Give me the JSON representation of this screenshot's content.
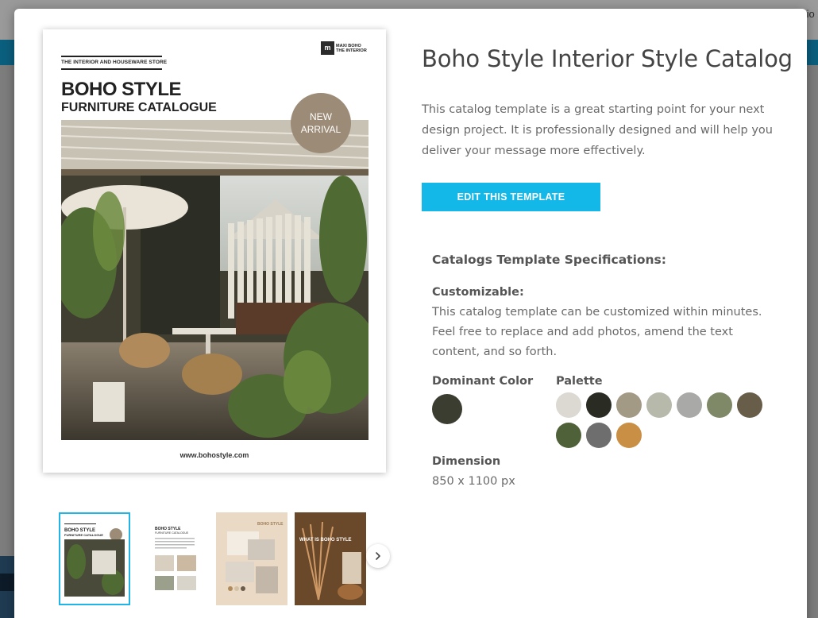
{
  "background": {
    "partial_text": "tio"
  },
  "template": {
    "title": "Boho Style Interior Style Catalog",
    "description": "This catalog template is a great starting point for your next design project. It is professionally designed and will help you deliver your message more effectively.",
    "cta_label": "EDIT THIS TEMPLATE"
  },
  "cover": {
    "store_name": "THE INTERIOR AND HOUSEWARE STORE",
    "title_line1": "BOHO STYLE",
    "title_line2": "FURNITURE CATALOGUE",
    "logo_mark": "m",
    "logo_text": "MAXI BOHO THE INTERIOR",
    "badge_line1": "NEW",
    "badge_line2": "ARRIVAL",
    "url": "www.bohostyle.com"
  },
  "thumbnails": {
    "thumb1": {
      "title": "BOHO STYLE",
      "subtitle": "FURNITURE CATALOGUE"
    },
    "thumb2": {
      "title": "BOHO STYLE",
      "subtitle": "FURNITURE CATALOGUE"
    },
    "thumb3": {
      "title": "BOHO STYLE"
    },
    "thumb4": {
      "title": "WHAT IS BOHO STYLE"
    },
    "next_icon": "chevron-right-icon"
  },
  "specs": {
    "section_title": "Catalogs Template Specifications:",
    "customizable_label": "Customizable:",
    "customizable_text": "This catalog template can be customized within minutes. Feel free to replace and add photos, amend the text content, and so forth.",
    "dominant_color_label": "Dominant Color",
    "dominant_color": "#3b3d30",
    "palette_label": "Palette",
    "palette": [
      "#dcd9d3",
      "#2a2c24",
      "#a39a86",
      "#b7b9ab",
      "#a9a9a7",
      "#7f8867",
      "#675d49",
      "#4f6138",
      "#6e6e6e",
      "#c98f44"
    ],
    "dimension_label": "Dimension",
    "dimension_value": "850 x 1100 px"
  },
  "colors": {
    "accent": "#14b8e8",
    "thumb_selected_border": "#1fb5e6",
    "badge": "#9c8b76"
  }
}
